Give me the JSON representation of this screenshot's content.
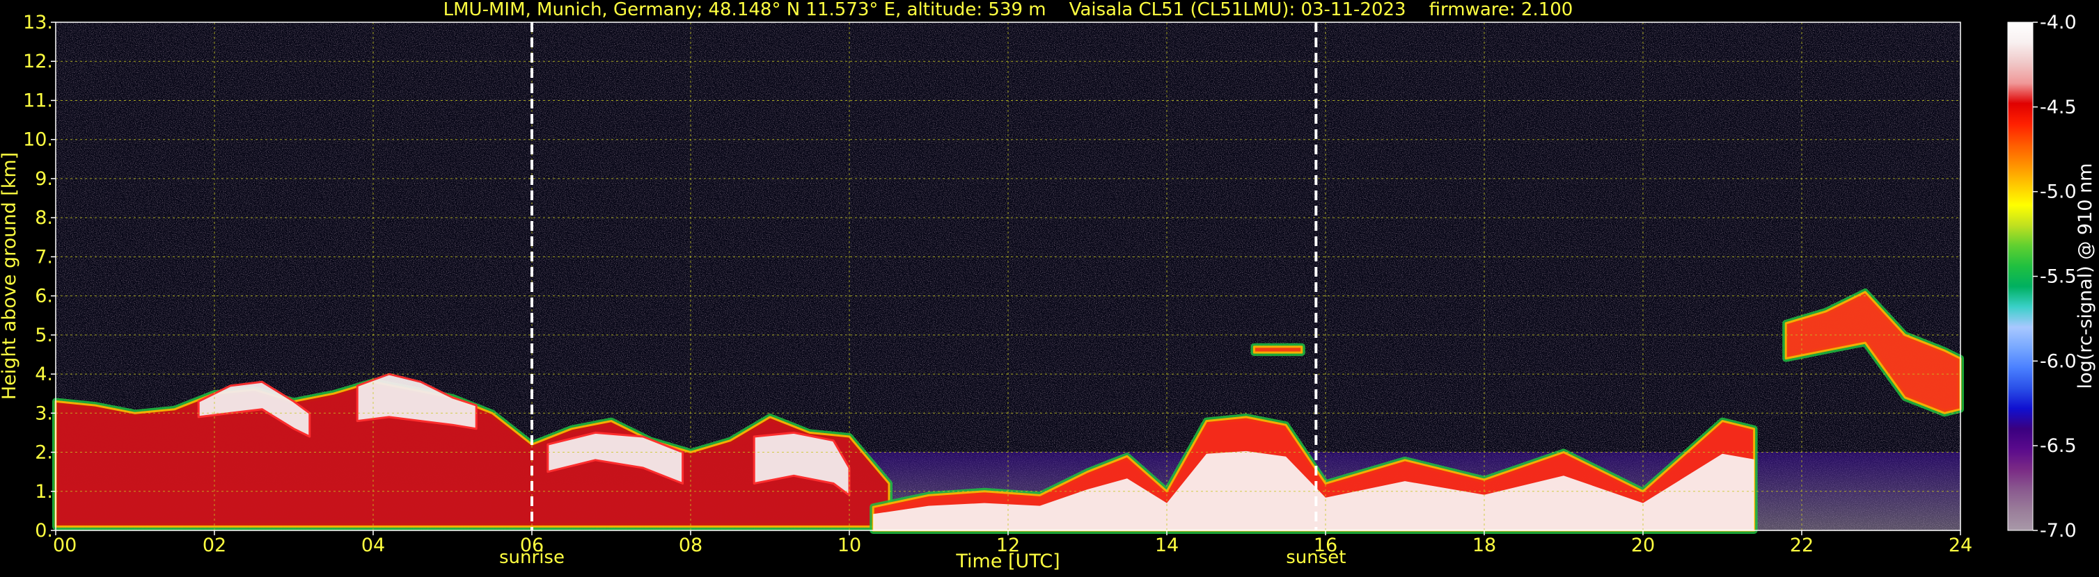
{
  "chart_data": {
    "type": "heatmap",
    "title": "LMU-MIM, Munich, Germany; 48.148° N 11.573° E, altitude: 539 m    Vaisala CL51 (CL51LMU): 03-11-2023    firmware: 2.100",
    "xlabel": "Time [UTC]",
    "ylabel": "Height above ground [km]",
    "xlim": [
      0,
      24
    ],
    "ylim": [
      0,
      13
    ],
    "x_ticks": [
      0,
      2,
      4,
      6,
      8,
      10,
      12,
      14,
      16,
      18,
      20,
      22,
      24
    ],
    "x_tick_labels": [
      "00",
      "02",
      "04",
      "06",
      "08",
      "10",
      "12",
      "14",
      "16",
      "18",
      "20",
      "22",
      "24"
    ],
    "y_ticks": [
      0,
      1,
      2,
      3,
      4,
      5,
      6,
      7,
      8,
      9,
      10,
      11,
      12,
      13
    ],
    "y_tick_labels": [
      "0.",
      "1.",
      "2.",
      "3.",
      "4.",
      "5.",
      "6.",
      "7.",
      "8.",
      "9.",
      "10.",
      "11.",
      "12.",
      "13."
    ],
    "grid": true,
    "colorbar": {
      "label": "log(rc-signal) @ 910 nm",
      "range": [
        -7.0,
        -4.0
      ],
      "ticks": [
        -4.0,
        -4.5,
        -5.0,
        -5.5,
        -6.0,
        -6.5,
        -7.0
      ],
      "tick_labels": [
        "-4.0",
        "-4.5",
        "-5.0",
        "-5.5",
        "-6.0",
        "-6.5",
        "-7.0"
      ],
      "colors": [
        "#a899a8",
        "#9a7d9a",
        "#8a5a8f",
        "#7a2a85",
        "#5a0a8c",
        "#3a0080",
        "#1010d0",
        "#2a50e8",
        "#4a80ff",
        "#78a8ff",
        "#a8c8ff",
        "#3ad0c8",
        "#00b060",
        "#20c040",
        "#60d030",
        "#c0e020",
        "#ffff00",
        "#ffc800",
        "#ff9000",
        "#ff5a00",
        "#ff2000",
        "#e00000",
        "#f09898",
        "#f0c8c8",
        "#f8f0f0",
        "#ffffff"
      ]
    },
    "annotations": [
      {
        "x": 6.0,
        "text": "sunrise"
      },
      {
        "x": 15.88,
        "text": "sunset"
      }
    ],
    "backscatter_layers": [
      {
        "name": "aerosol layer",
        "x": [
          0.0,
          0.5,
          1.0,
          1.5,
          2.0,
          2.5,
          3.0,
          3.5,
          4.0,
          4.5,
          5.0,
          5.5,
          6.0,
          6.5,
          7.0,
          7.5,
          8.0,
          8.5,
          9.0,
          9.5,
          10.0,
          10.5
        ],
        "top": [
          3.3,
          3.2,
          3.0,
          3.1,
          3.5,
          3.6,
          3.3,
          3.5,
          3.8,
          3.6,
          3.4,
          3.0,
          2.2,
          2.6,
          2.8,
          2.3,
          2.0,
          2.3,
          2.9,
          2.5,
          2.4,
          1.2
        ],
        "bottom": [
          0.1,
          0.1,
          0.1,
          0.1,
          0.1,
          0.1,
          0.1,
          0.1,
          0.1,
          0.1,
          0.1,
          0.1,
          0.1,
          0.1,
          0.1,
          0.1,
          0.1,
          0.1,
          0.1,
          0.1,
          0.1,
          0.1
        ]
      },
      {
        "name": "white backscatter",
        "x": [
          1.8,
          2.2,
          2.6,
          3.0,
          3.2
        ],
        "top": [
          3.3,
          3.7,
          3.8,
          3.3,
          3.0
        ],
        "bottom": [
          2.9,
          3.0,
          3.1,
          2.6,
          2.4
        ]
      },
      {
        "name": "white backscatter",
        "x": [
          3.8,
          4.2,
          4.6,
          5.0,
          5.3
        ],
        "top": [
          3.7,
          4.0,
          3.8,
          3.4,
          3.2
        ],
        "bottom": [
          2.8,
          2.9,
          2.8,
          2.7,
          2.6
        ]
      },
      {
        "name": "white backscatter",
        "x": [
          6.2,
          6.8,
          7.4,
          7.9
        ],
        "top": [
          2.2,
          2.5,
          2.4,
          2.0
        ],
        "bottom": [
          1.5,
          1.8,
          1.6,
          1.2
        ]
      },
      {
        "name": "white backscatter",
        "x": [
          8.8,
          9.3,
          9.8,
          10.0
        ],
        "top": [
          2.4,
          2.5,
          2.3,
          1.6
        ],
        "bottom": [
          1.2,
          1.4,
          1.2,
          0.9
        ]
      },
      {
        "name": "low cloud / fog",
        "x": [
          10.3,
          11.0,
          11.7,
          12.4,
          13.0,
          13.5,
          14.0,
          14.5,
          15.0,
          15.5,
          16.0,
          17.0,
          18.0,
          19.0,
          20.0,
          21.0,
          21.4
        ],
        "top": [
          0.6,
          0.9,
          1.0,
          0.9,
          1.5,
          1.9,
          1.0,
          2.8,
          2.9,
          2.7,
          1.2,
          1.8,
          1.3,
          2.0,
          1.0,
          2.8,
          2.6
        ],
        "bottom": [
          0.0,
          0.0,
          0.0,
          0.0,
          0.0,
          0.0,
          0.0,
          0.0,
          0.0,
          0.0,
          0.0,
          0.0,
          0.0,
          0.0,
          0.0,
          0.0,
          0.0
        ]
      },
      {
        "name": "cloud layer",
        "x": [
          21.8,
          22.3,
          22.8,
          23.3,
          23.8,
          24.0
        ],
        "top": [
          5.3,
          5.6,
          6.1,
          5.0,
          4.6,
          4.4
        ],
        "bottom": [
          4.4,
          4.6,
          4.8,
          3.4,
          3.0,
          3.1
        ]
      },
      {
        "name": "cloud layer",
        "x": [
          15.1,
          15.4,
          15.7
        ],
        "top": [
          4.7,
          4.7,
          4.7
        ],
        "bottom": [
          4.55,
          4.55,
          4.55
        ]
      }
    ]
  }
}
